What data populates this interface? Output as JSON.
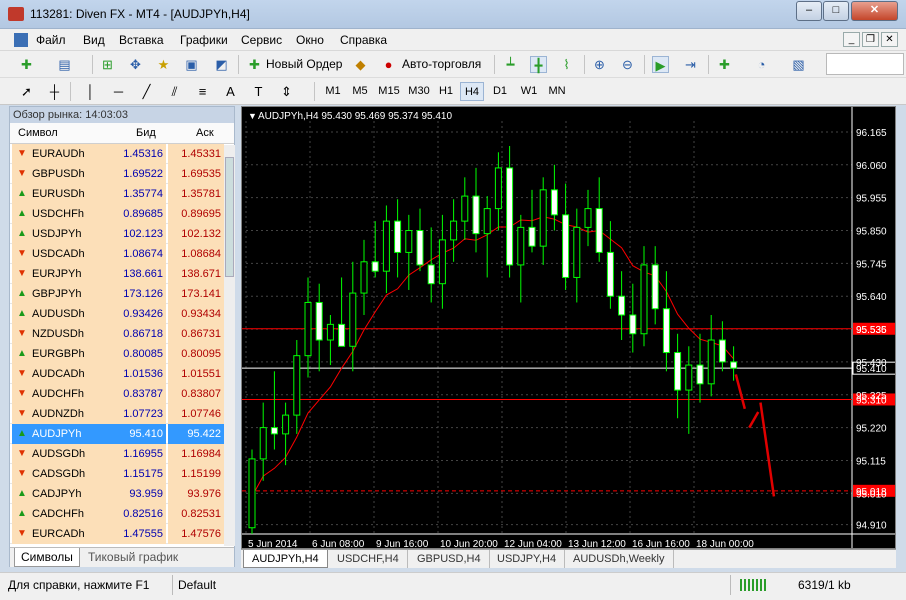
{
  "window": {
    "title": "113281: Diven FX - MT4 - [AUDJPYh,H4]",
    "minimize": "–",
    "maximize": "□",
    "close": "✕"
  },
  "menu": [
    "Файл",
    "Вид",
    "Вставка",
    "Графики",
    "Сервис",
    "Окно",
    "Справка"
  ],
  "toolbar": {
    "new_order": "Новый Ордер",
    "auto_trading": "Авто-торговля",
    "timeframes": [
      "M1",
      "M5",
      "M15",
      "M30",
      "H1",
      "H4",
      "D1",
      "W1",
      "MN"
    ],
    "active_timeframe": "H4",
    "icons": [
      "new-chart-icon",
      "profiles-icon",
      "market-watch-icon",
      "navigator-icon",
      "data-window-icon",
      "terminal-icon",
      "tester-icon",
      "cursor-icon",
      "crosshair-icon",
      "vertical-line-icon",
      "horizontal-line-icon",
      "trendline-icon",
      "equidistant-channel-icon",
      "fibonacci-icon",
      "text-icon",
      "text-label-icon",
      "arrows-icon",
      "bar-chart-icon",
      "candlestick-icon",
      "line-chart-icon",
      "zoom-in-icon",
      "zoom-out-icon",
      "autoscroll-icon",
      "chart-shift-icon",
      "indicators-icon",
      "periods-icon",
      "templates-icon"
    ]
  },
  "market_watch": {
    "header": "Обзор рынка: 14:03:03",
    "columns": [
      "Символ",
      "Бид",
      "Аск"
    ],
    "rows": [
      {
        "symbol": "EURAUDh",
        "bid": "1.45316",
        "ask": "1.45331",
        "dir": "down"
      },
      {
        "symbol": "GBPUSDh",
        "bid": "1.69522",
        "ask": "1.69535",
        "dir": "down"
      },
      {
        "symbol": "EURUSDh",
        "bid": "1.35774",
        "ask": "1.35781",
        "dir": "up"
      },
      {
        "symbol": "USDCHFh",
        "bid": "0.89685",
        "ask": "0.89695",
        "dir": "up"
      },
      {
        "symbol": "USDJPYh",
        "bid": "102.123",
        "ask": "102.132",
        "dir": "up"
      },
      {
        "symbol": "USDCADh",
        "bid": "1.08674",
        "ask": "1.08684",
        "dir": "down"
      },
      {
        "symbol": "EURJPYh",
        "bid": "138.661",
        "ask": "138.671",
        "dir": "down"
      },
      {
        "symbol": "GBPJPYh",
        "bid": "173.126",
        "ask": "173.141",
        "dir": "up"
      },
      {
        "symbol": "AUDUSDh",
        "bid": "0.93426",
        "ask": "0.93434",
        "dir": "up"
      },
      {
        "symbol": "NZDUSDh",
        "bid": "0.86718",
        "ask": "0.86731",
        "dir": "down"
      },
      {
        "symbol": "EURGBPh",
        "bid": "0.80085",
        "ask": "0.80095",
        "dir": "up"
      },
      {
        "symbol": "AUDCADh",
        "bid": "1.01536",
        "ask": "1.01551",
        "dir": "down"
      },
      {
        "symbol": "AUDCHFh",
        "bid": "0.83787",
        "ask": "0.83807",
        "dir": "down"
      },
      {
        "symbol": "AUDNZDh",
        "bid": "1.07723",
        "ask": "1.07746",
        "dir": "down"
      },
      {
        "symbol": "AUDJPYh",
        "bid": "95.410",
        "ask": "95.422",
        "dir": "up",
        "selected": true
      },
      {
        "symbol": "AUDSGDh",
        "bid": "1.16955",
        "ask": "1.16984",
        "dir": "down"
      },
      {
        "symbol": "CADSGDh",
        "bid": "1.15175",
        "ask": "1.15199",
        "dir": "down"
      },
      {
        "symbol": "CADJPYh",
        "bid": "93.959",
        "ask": "93.976",
        "dir": "up"
      },
      {
        "symbol": "CADCHFh",
        "bid": "0.82516",
        "ask": "0.82531",
        "dir": "up"
      },
      {
        "symbol": "EURCADh",
        "bid": "1.47555",
        "ask": "1.47576",
        "dir": "down"
      }
    ],
    "tabs": [
      "Символы",
      "Тиковый график"
    ],
    "active_tab": "Символы"
  },
  "chart": {
    "header": "AUDJPYh,H4  95.430 95.469 95.374 95.410",
    "tabs": [
      "AUDJPYh,H4",
      "USDCHF,H4",
      "GBPUSD,H4",
      "USDJPY,H4",
      "AUDUSDh,Weekly"
    ],
    "active_tab": "AUDJPYh,H4"
  },
  "chart_data": {
    "type": "candlestick",
    "symbol": "AUDJPYh",
    "timeframe": "H4",
    "ohlc_last": {
      "open": 95.43,
      "high": 95.469,
      "low": 95.374,
      "close": 95.41
    },
    "ylim": [
      94.88,
      96.2
    ],
    "y_ticks": [
      "96.165",
      "96.060",
      "95.955",
      "95.850",
      "95.745",
      "95.640",
      "95.535",
      "95.430",
      "95.325",
      "95.220",
      "95.115",
      "95.010",
      "94.910"
    ],
    "x_ticks": [
      "5 Jun 2014",
      "6 Jun 08:00",
      "9 Jun 16:00",
      "10 Jun 20:00",
      "12 Jun 04:00",
      "13 Jun 12:00",
      "16 Jun 16:00",
      "18 Jun 00:00"
    ],
    "horizontal_levels": [
      {
        "value": 95.536,
        "label": "95.536",
        "color": "#ff0000",
        "style": "solid"
      },
      {
        "value": 95.41,
        "label": "95.410",
        "color": "#ffffff",
        "style": "solid",
        "role": "bid"
      },
      {
        "value": 95.31,
        "label": "95.310",
        "color": "#ff0000",
        "style": "solid"
      },
      {
        "value": 95.018,
        "label": "95.018",
        "color": "#ff0000",
        "style": "dashed"
      }
    ],
    "moving_average_color": "#ff0000",
    "bull_color": "#00ff00",
    "bear_color": "#ffffff",
    "candles": [
      [
        94.9,
        95.15,
        94.88,
        95.12
      ],
      [
        95.12,
        95.3,
        95.05,
        95.22
      ],
      [
        95.22,
        95.4,
        95.15,
        95.2
      ],
      [
        95.2,
        95.3,
        95.1,
        95.26
      ],
      [
        95.26,
        95.5,
        95.2,
        95.45
      ],
      [
        95.45,
        95.7,
        95.38,
        95.62
      ],
      [
        95.62,
        95.68,
        95.4,
        95.5
      ],
      [
        95.5,
        95.58,
        95.42,
        95.55
      ],
      [
        95.55,
        95.7,
        95.48,
        95.48
      ],
      [
        95.48,
        95.75,
        95.4,
        95.65
      ],
      [
        95.65,
        95.82,
        95.58,
        95.75
      ],
      [
        95.75,
        95.88,
        95.7,
        95.72
      ],
      [
        95.72,
        95.93,
        95.65,
        95.88
      ],
      [
        95.88,
        95.95,
        95.7,
        95.78
      ],
      [
        95.78,
        95.9,
        95.66,
        95.85
      ],
      [
        95.85,
        95.92,
        95.72,
        95.74
      ],
      [
        95.74,
        95.86,
        95.62,
        95.68
      ],
      [
        95.68,
        95.9,
        95.6,
        95.82
      ],
      [
        95.82,
        95.95,
        95.75,
        95.88
      ],
      [
        95.88,
        96.02,
        95.82,
        95.96
      ],
      [
        95.96,
        96.05,
        95.78,
        95.84
      ],
      [
        95.84,
        95.96,
        95.7,
        95.92
      ],
      [
        95.92,
        96.1,
        95.85,
        96.05
      ],
      [
        96.05,
        96.12,
        95.7,
        95.74
      ],
      [
        95.74,
        95.9,
        95.62,
        95.86
      ],
      [
        95.86,
        95.98,
        95.78,
        95.8
      ],
      [
        95.8,
        96.02,
        95.74,
        95.98
      ],
      [
        95.98,
        96.06,
        95.85,
        95.9
      ],
      [
        95.9,
        96.0,
        95.66,
        95.7
      ],
      [
        95.7,
        95.92,
        95.62,
        95.86
      ],
      [
        95.86,
        95.98,
        95.8,
        95.92
      ],
      [
        95.92,
        96.02,
        95.75,
        95.78
      ],
      [
        95.78,
        95.88,
        95.6,
        95.64
      ],
      [
        95.64,
        95.72,
        95.5,
        95.58
      ],
      [
        95.58,
        95.68,
        95.46,
        95.52
      ],
      [
        95.52,
        95.8,
        95.48,
        95.74
      ],
      [
        95.74,
        95.8,
        95.55,
        95.6
      ],
      [
        95.6,
        95.72,
        95.4,
        95.46
      ],
      [
        95.46,
        95.52,
        95.25,
        95.34
      ],
      [
        95.34,
        95.48,
        95.2,
        95.42
      ],
      [
        95.42,
        95.52,
        95.3,
        95.36
      ],
      [
        95.36,
        95.58,
        95.32,
        95.5
      ],
      [
        95.5,
        95.56,
        95.4,
        95.43
      ],
      [
        95.43,
        95.48,
        95.37,
        95.41
      ]
    ],
    "arrows": [
      {
        "from": [
          43.2,
          95.39
        ],
        "to": [
          44.0,
          95.28
        ]
      },
      {
        "from": [
          44.4,
          95.22
        ],
        "to": [
          45.2,
          95.27
        ]
      },
      {
        "from": [
          45.4,
          95.3
        ],
        "to": [
          46.6,
          95.0
        ]
      }
    ]
  },
  "status": {
    "help": "Для справки, нажмите F1",
    "profile": "Default",
    "traffic": "6319/1 kb"
  }
}
